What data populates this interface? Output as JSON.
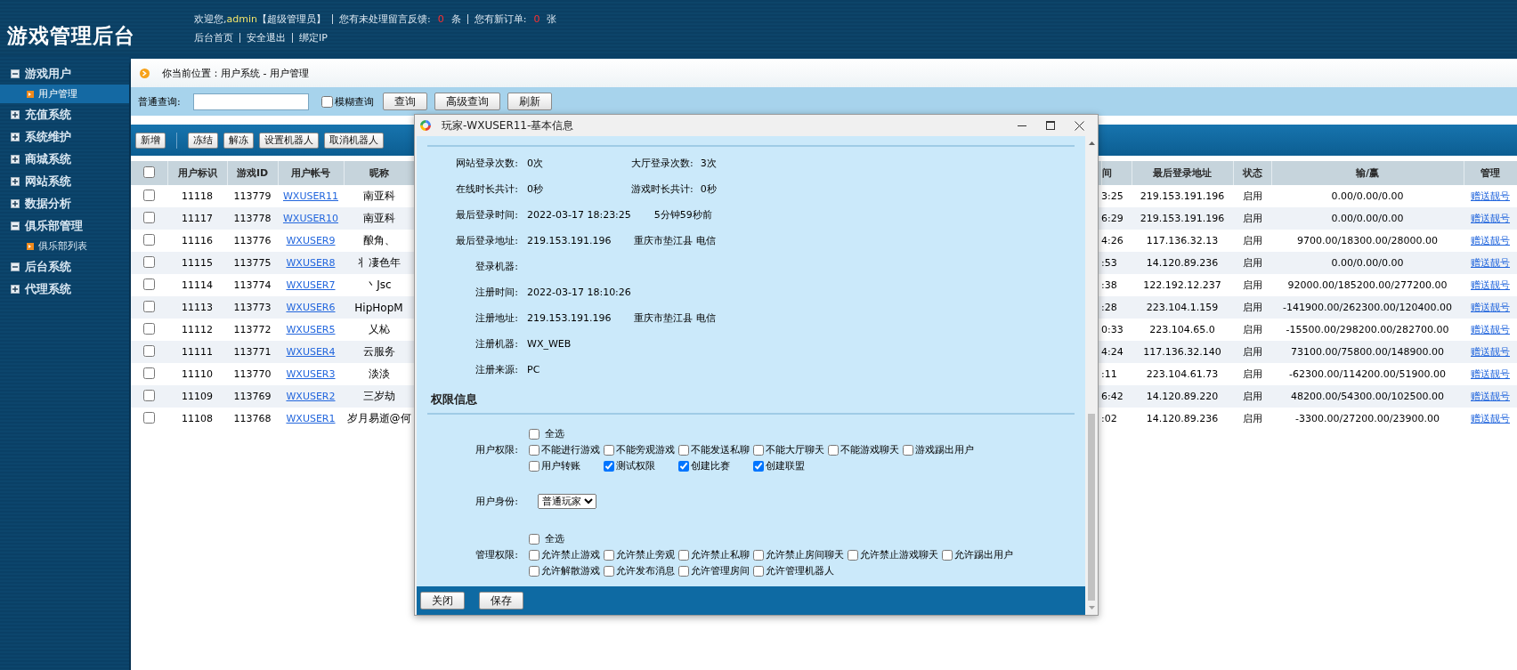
{
  "header": {
    "title": "游戏管理后台",
    "welcome": {
      "greeting": "欢迎您,",
      "user": "admin",
      "role": "【超级管理员】",
      "feedback_label": "您有未处理留言反馈:",
      "feedback_count": "0",
      "feedback_unit": "条",
      "order_label": "您有新订单:",
      "order_count": "0",
      "order_unit": "张"
    },
    "links": [
      "后台首页",
      "安全退出",
      "绑定IP"
    ]
  },
  "sidebar": {
    "items": [
      {
        "label": "游戏用户",
        "expanded": true,
        "children": [
          {
            "label": "用户管理",
            "selected": true
          }
        ]
      },
      {
        "label": "充值系统",
        "expanded": false
      },
      {
        "label": "系统维护",
        "expanded": false
      },
      {
        "label": "商城系统",
        "expanded": false
      },
      {
        "label": "网站系统",
        "expanded": false
      },
      {
        "label": "数据分析",
        "expanded": false
      },
      {
        "label": "俱乐部管理",
        "expanded": true,
        "children": [
          {
            "label": "俱乐部列表",
            "selected": false
          }
        ]
      },
      {
        "label": "后台系统",
        "expanded": true
      },
      {
        "label": "代理系统",
        "expanded": false
      }
    ]
  },
  "breadcrumb": "你当前位置：用户系统 - 用户管理",
  "search": {
    "label": "普通查询:",
    "fuzzy": {
      "label": "模糊查询",
      "checked": false
    },
    "buttons": [
      "查询",
      "高级查询",
      "刷新"
    ]
  },
  "toolbar": {
    "buttons": [
      "新增",
      "冻结",
      "解冻",
      "设置机器人",
      "取消机器人"
    ]
  },
  "table": {
    "select_all_checked": false,
    "columns": [
      "用户标识",
      "游戏ID",
      "用户帐号",
      "昵称",
      "间",
      "最后登录地址",
      "状态",
      "输/赢",
      "管理"
    ],
    "rows": [
      {
        "checked": false,
        "cells": [
          "11118",
          "113779",
          "WXUSER11",
          "南亚科",
          "3:25",
          "219.153.191.196",
          "启用",
          "0.00/0.00/0.00",
          "赠送靓号"
        ]
      },
      {
        "checked": false,
        "cells": [
          "11117",
          "113778",
          "WXUSER10",
          "南亚科",
          "6:29",
          "219.153.191.196",
          "启用",
          "0.00/0.00/0.00",
          "赠送靓号"
        ]
      },
      {
        "checked": false,
        "cells": [
          "11116",
          "113776",
          "WXUSER9",
          "酿角、",
          "4:26",
          "117.136.32.13",
          "启用",
          "9700.00/18300.00/28000.00",
          "赠送靓号"
        ]
      },
      {
        "checked": false,
        "cells": [
          "11115",
          "113775",
          "WXUSER8",
          "丬凄色年",
          ":53",
          "14.120.89.236",
          "启用",
          "0.00/0.00/0.00",
          "赠送靓号"
        ]
      },
      {
        "checked": false,
        "cells": [
          "11114",
          "113774",
          "WXUSER7",
          "丶Jsc",
          ":38",
          "122.192.12.237",
          "启用",
          "92000.00/185200.00/277200.00",
          "赠送靓号"
        ]
      },
      {
        "checked": false,
        "cells": [
          "11113",
          "113773",
          "WXUSER6",
          "HipHopM",
          ":28",
          "223.104.1.159",
          "启用",
          "-141900.00/262300.00/120400.00",
          "赠送靓号"
        ]
      },
      {
        "checked": false,
        "cells": [
          "11112",
          "113772",
          "WXUSER5",
          "乂杺",
          "0:33",
          "223.104.65.0",
          "启用",
          "-15500.00/298200.00/282700.00",
          "赠送靓号"
        ]
      },
      {
        "checked": false,
        "cells": [
          "11111",
          "113771",
          "WXUSER4",
          "云服务",
          "4:24",
          "117.136.32.140",
          "启用",
          "73100.00/75800.00/148900.00",
          "赠送靓号"
        ]
      },
      {
        "checked": false,
        "cells": [
          "11110",
          "113770",
          "WXUSER3",
          "淡淡",
          ":11",
          "223.104.61.73",
          "启用",
          "-62300.00/114200.00/51900.00",
          "赠送靓号"
        ]
      },
      {
        "checked": false,
        "cells": [
          "11109",
          "113769",
          "WXUSER2",
          "三岁劫",
          "6:42",
          "14.120.89.220",
          "启用",
          "48200.00/54300.00/102500.00",
          "赠送靓号"
        ]
      },
      {
        "checked": false,
        "cells": [
          "11108",
          "113768",
          "WXUSER1",
          "岁月易逝@何",
          ":02",
          "14.120.89.236",
          "启用",
          "-3300.00/27200.00/23900.00",
          "赠送靓号"
        ]
      }
    ]
  },
  "dialog": {
    "title": "玩家-WXUSER11-基本信息",
    "info_rows": [
      {
        "fields": [
          {
            "label": "网站登录次数:",
            "value": "0次"
          },
          {
            "label": "大厅登录次数:",
            "value": "3次"
          }
        ]
      },
      {
        "fields": [
          {
            "label": "在线时长共计:",
            "value": "0秒"
          },
          {
            "label": "游戏时长共计:",
            "value": "0秒"
          }
        ]
      },
      {
        "fields": [
          {
            "label": "最后登录时间:",
            "value": "2022-03-17 18:23:25"
          }
        ],
        "note": "5分钟59秒前"
      },
      {
        "fields": [
          {
            "label": "最后登录地址:",
            "value": "219.153.191.196"
          }
        ],
        "note": "重庆市垫江县 电信"
      },
      {
        "fields": [
          {
            "label": "登录机器:"
          }
        ]
      },
      {
        "fields": [
          {
            "label": "注册时间:",
            "value": "2022-03-17 18:10:26"
          }
        ]
      },
      {
        "fields": [
          {
            "label": "注册地址:",
            "value": "219.153.191.196"
          }
        ],
        "note": "重庆市垫江县 电信"
      },
      {
        "fields": [
          {
            "label": "注册机器:",
            "value": "WX_WEB"
          }
        ]
      },
      {
        "fields": [
          {
            "label": "注册来源:",
            "value": "PC"
          }
        ]
      }
    ],
    "permissions_heading": "权限信息",
    "groups": [
      {
        "kind": "checks",
        "label": "用户权限:",
        "select_all": {
          "label": "全选",
          "checked": false
        },
        "options": [
          {
            "label": "不能进行游戏",
            "checked": false
          },
          {
            "label": "不能旁观游戏",
            "checked": false
          },
          {
            "label": "不能发送私聊",
            "checked": false
          },
          {
            "label": "不能大厅聊天",
            "checked": false
          },
          {
            "label": "不能游戏聊天",
            "checked": false
          },
          {
            "label": "游戏踢出用户",
            "checked": false
          },
          {
            "label": "用户转账",
            "checked": false
          },
          {
            "label": "测试权限",
            "checked": true
          },
          {
            "label": "创建比赛",
            "checked": true
          },
          {
            "label": "创建联盟",
            "checked": true
          }
        ]
      },
      {
        "kind": "select",
        "label": "用户身份:",
        "value": "普通玩家"
      },
      {
        "kind": "checks",
        "label": "管理权限:",
        "select_all": {
          "label": "全选",
          "checked": false
        },
        "options": [
          {
            "label": "允许禁止游戏",
            "checked": false
          },
          {
            "label": "允许禁止旁观",
            "checked": false
          },
          {
            "label": "允许禁止私聊",
            "checked": false
          },
          {
            "label": "允许禁止房间聊天",
            "checked": false
          },
          {
            "label": "允许禁止游戏聊天",
            "checked": false
          },
          {
            "label": "允许踢出用户",
            "checked": false
          },
          {
            "label": "允许解散游戏",
            "checked": false
          },
          {
            "label": "允许发布消息",
            "checked": false
          },
          {
            "label": "允许管理房间",
            "checked": false
          },
          {
            "label": "允许管理机器人",
            "checked": false
          }
        ]
      }
    ],
    "buttons": [
      "关闭",
      "保存"
    ]
  }
}
